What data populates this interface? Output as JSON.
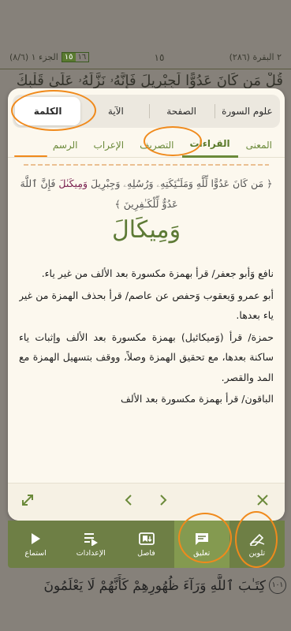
{
  "mushaf": {
    "surah_name": "٢ البقرة (٢٨٦)",
    "page_number": "١٥",
    "juz_label": "الجزء ١ (٨/٦)",
    "juz_badge_a": "١٥",
    "juz_badge_b": "١٦",
    "top_line": "قُلْ مَن كَانَ عَدُوًّا لِّجِبْرِيلَ فَإِنَّهُۥ نَزَّلَهُۥ عَلَىٰ قَلْبِكَ",
    "bottom_line": "كِتَـٰبَ ٱللَّهِ وَرَآءَ ظُهُورِهِمْ كَأَنَّهُمْ لَا يَعْلَمُونَ",
    "bottom_ayah_number": "١٠١"
  },
  "tabs_primary": [
    {
      "label": "علوم السورة"
    },
    {
      "label": "الصفحة"
    },
    {
      "label": "الآية"
    },
    {
      "label": "الكلمة"
    }
  ],
  "tabs_secondary": [
    {
      "label": "المعنى"
    },
    {
      "label": "القراءات"
    },
    {
      "label": "التصريف"
    },
    {
      "label": "الإعراب"
    },
    {
      "label": "الرسم"
    }
  ],
  "ayah": {
    "open": "﴿",
    "part1": "مَن كَانَ عَدُوًّا لِّلَّهِ وَمَلَـٰٓئِكَتِهِۦ وَرُسُلِهِۦ",
    "part2": "وَجِبْرِيلَ",
    "highlight": "وَمِيكَىٰلَ",
    "part3": "فَإِنَّ ٱللَّهَ عَدُوٌّ لِّلْكَـٰفِرِينَ",
    "close": "﴾"
  },
  "word": "وَمِيكَالَ",
  "content": {
    "p1": "نافع وَأبو جعفر/ قرأ بهمزة مكسورة بعد الألف من غير ياء.",
    "p2": "أبو عمرو وَيعقوب وَحفص عن عاصم/ قرأ بحذف الهمزة من غير ياء بعدها.",
    "p3": "حمزة/ قرأ (وَميكائيل) بهمزة مكسورة بعد الألف وإثبات ياء ساكنة بعدها، مع تحقيق الهمزة وصلاً، ووقف بتسهيل الهمزة مع المد والقصر.",
    "p4": "الباقون/ قرأ بهمزة مكسورة بعد الألف"
  },
  "toolbar": [
    {
      "label": "تلوين",
      "icon": "pen-icon"
    },
    {
      "label": "تعليق",
      "icon": "comment-icon"
    },
    {
      "label": "فاصل",
      "icon": "bookmark-icon"
    },
    {
      "label": "الإعدادات",
      "icon": "settings-list-icon"
    },
    {
      "label": "استماع",
      "icon": "play-icon"
    }
  ],
  "colors": {
    "accent": "#6b8a3a",
    "toolbar": "#6e7f45",
    "annotation": "#f08a1c",
    "highlight_word": "#7a2050"
  }
}
